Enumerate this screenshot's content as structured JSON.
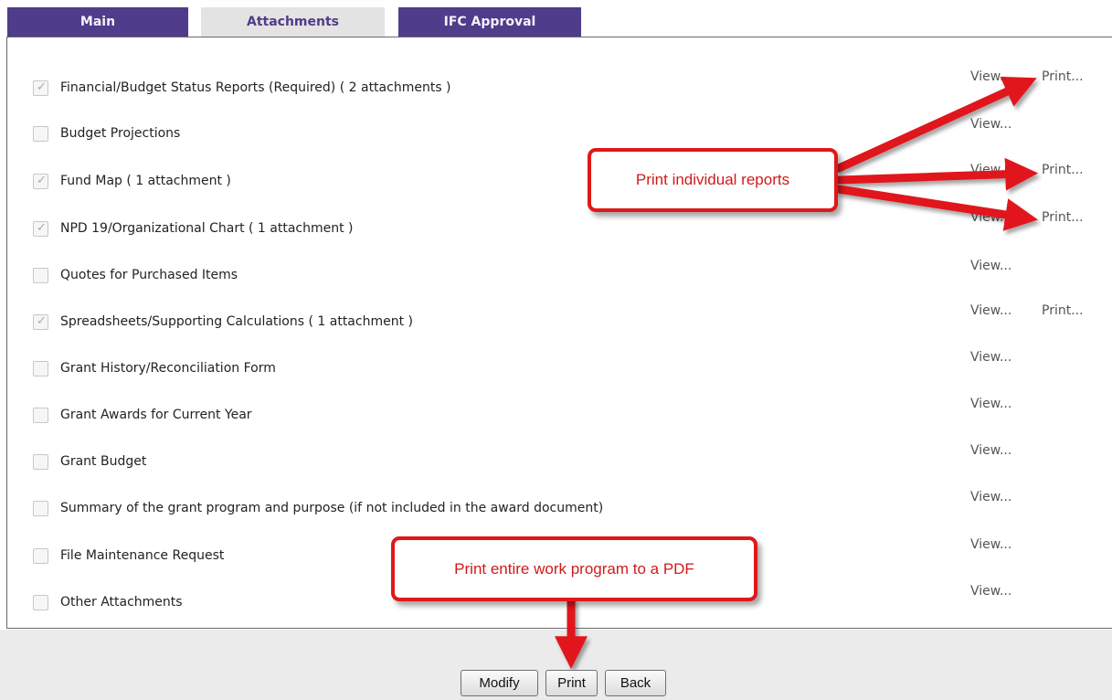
{
  "tabs": [
    {
      "label": "Main",
      "active": false
    },
    {
      "label": "Attachments",
      "active": true
    },
    {
      "label": "IFC Approval",
      "active": false
    }
  ],
  "attachments": [
    {
      "label": "Financial/Budget Status Reports (Required) ( 2 attachments )",
      "checked": true,
      "view": "View...",
      "print": "Print..."
    },
    {
      "label": "Budget Projections",
      "checked": false,
      "view": "View...",
      "print": ""
    },
    {
      "label": "Fund Map ( 1 attachment )",
      "checked": true,
      "view": "View...",
      "print": "Print..."
    },
    {
      "label": "NPD 19/Organizational Chart ( 1 attachment )",
      "checked": true,
      "view": "View...",
      "print": "Print..."
    },
    {
      "label": "Quotes for Purchased Items",
      "checked": false,
      "view": "View...",
      "print": ""
    },
    {
      "label": "Spreadsheets/Supporting Calculations ( 1 attachment )",
      "checked": true,
      "view": "View...",
      "print": "Print..."
    },
    {
      "label": "Grant History/Reconciliation Form",
      "checked": false,
      "view": "View...",
      "print": ""
    },
    {
      "label": "Grant Awards for Current Year",
      "checked": false,
      "view": "View...",
      "print": ""
    },
    {
      "label": "Grant Budget",
      "checked": false,
      "view": "View...",
      "print": ""
    },
    {
      "label": "Summary of the grant program and purpose (if not included in the award document)",
      "checked": false,
      "view": "View...",
      "print": ""
    },
    {
      "label": "File Maintenance Request",
      "checked": false,
      "view": "View...",
      "print": ""
    },
    {
      "label": "Other Attachments",
      "checked": false,
      "view": "View...",
      "print": ""
    }
  ],
  "callouts": {
    "individual": "Print individual reports",
    "entire": "Print entire work program to a PDF"
  },
  "buttons": {
    "modify": "Modify",
    "print": "Print",
    "back": "Back"
  },
  "colors": {
    "tab_purple": "#4f3c8a",
    "callout_red": "#e0181a"
  }
}
